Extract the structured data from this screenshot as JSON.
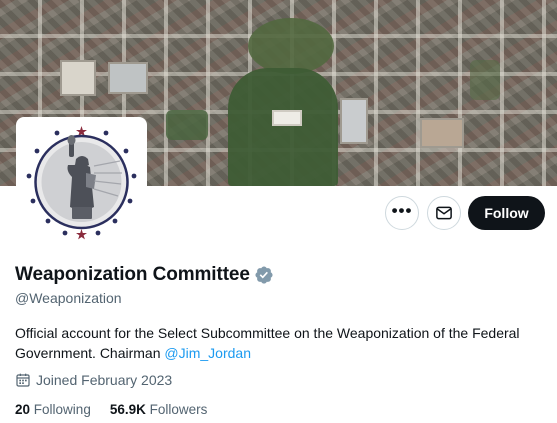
{
  "banner": {
    "image_name": "aerial-city-banner"
  },
  "avatar": {
    "image_name": "statue-of-liberty-seal"
  },
  "actions": {
    "more_icon": "more-horizontal-icon",
    "more_glyph": "•••",
    "message_icon": "envelope-icon",
    "follow_label": "Follow"
  },
  "profile": {
    "display_name": "Weaponization Committee",
    "verified_icon": "verified-badge-icon",
    "handle": "@Weaponization",
    "bio_text": "Official account for the Select Subcommittee on the Weaponization of the Federal Government. Chairman ",
    "bio_mention": "@Jim_Jordan",
    "joined_icon": "calendar-icon",
    "joined": "Joined February 2023"
  },
  "stats": {
    "following_count": "20",
    "following_label": "Following",
    "followers_count": "56.9K",
    "followers_label": "Followers"
  },
  "colors": {
    "accent_link": "#1d9bf0",
    "verified_badge": "#829aab",
    "follow_button_bg": "#0f1419",
    "secondary_text": "#536471"
  }
}
